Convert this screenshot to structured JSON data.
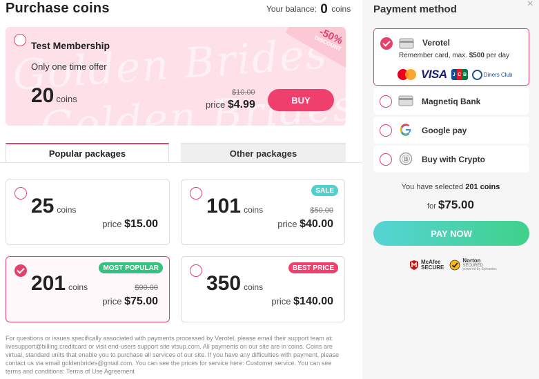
{
  "header": {
    "title": "Purchase coins",
    "balance_label": "Your balance:",
    "balance_value": "0",
    "balance_unit": "coins"
  },
  "trial": {
    "name": "Test Membership",
    "offer": "Only one time offer",
    "coins": "20",
    "coins_unit": "coins",
    "old_price": "$10.00",
    "price_label": "price",
    "price": "$4.99",
    "buy_label": "BUY",
    "discount_pct": "-50%",
    "discount_label": "DISCOUNT",
    "watermark": "Golden Brides"
  },
  "tabs": [
    {
      "label": "Popular packages",
      "active": true
    },
    {
      "label": "Other packages",
      "active": false
    }
  ],
  "packages": [
    {
      "coins": "25",
      "unit": "coins",
      "price_label": "price",
      "price": "$15.00",
      "old_price": "",
      "badge": "",
      "selected": false
    },
    {
      "coins": "101",
      "unit": "coins",
      "price_label": "price",
      "price": "$40.00",
      "old_price": "$50.00",
      "badge": "SALE",
      "selected": false
    },
    {
      "coins": "201",
      "unit": "coins",
      "price_label": "price",
      "price": "$75.00",
      "old_price": "$90.00",
      "badge": "MOST POPULAR",
      "selected": true
    },
    {
      "coins": "350",
      "unit": "coins",
      "price_label": "price",
      "price": "$140.00",
      "old_price": "",
      "badge": "BEST PRICE",
      "selected": false
    }
  ],
  "footer": {
    "text": "For questions or issues specifically associated with payments processed by Verotel, please email their support team at: livesupport@billing.creditcard or visit end-users support site vtsup.com. All payments on our site are in coins. Coins are virtual, standard units that enable you to purchase all services of our site. If you have any difficulties with payment, please contact us via email goldenbrides@gmail.com. You can see the prices for service here: Customer service. You can see terms and conditions: Terms of Use Agreement"
  },
  "payment": {
    "title": "Payment method",
    "close": "×",
    "methods": [
      {
        "name": "Verotel",
        "icon": "card-icon",
        "selected": true,
        "note_prefix": "Remember card, max.",
        "note_amount": "$500",
        "note_suffix": "per day"
      },
      {
        "name": "Magnetiq Bank",
        "icon": "card-icon",
        "selected": false
      },
      {
        "name": "Google pay",
        "icon": "google-icon",
        "selected": false
      },
      {
        "name": "Buy with Crypto",
        "icon": "crypto-icon",
        "selected": false
      }
    ],
    "cards": {
      "visa": "VISA",
      "jcb": [
        "J",
        "C",
        "B"
      ],
      "diners": "Diners Club"
    },
    "selected_prefix": "You have selected",
    "selected_coins": "201 coins",
    "for_label": "for",
    "for_price": "$75.00",
    "pay_label": "PAY NOW",
    "seals": {
      "mcafee": [
        "McAfee",
        "SECURE"
      ],
      "norton": [
        "Norton",
        "SECURED",
        "powered by Symantec"
      ]
    }
  },
  "colors": {
    "accent": "#e2426b",
    "buy": "#ef3f6d",
    "sale": "#4fd1d0",
    "popular": "#33c27f",
    "pay_from": "#56d4d6",
    "pay_to": "#3fd18a"
  }
}
